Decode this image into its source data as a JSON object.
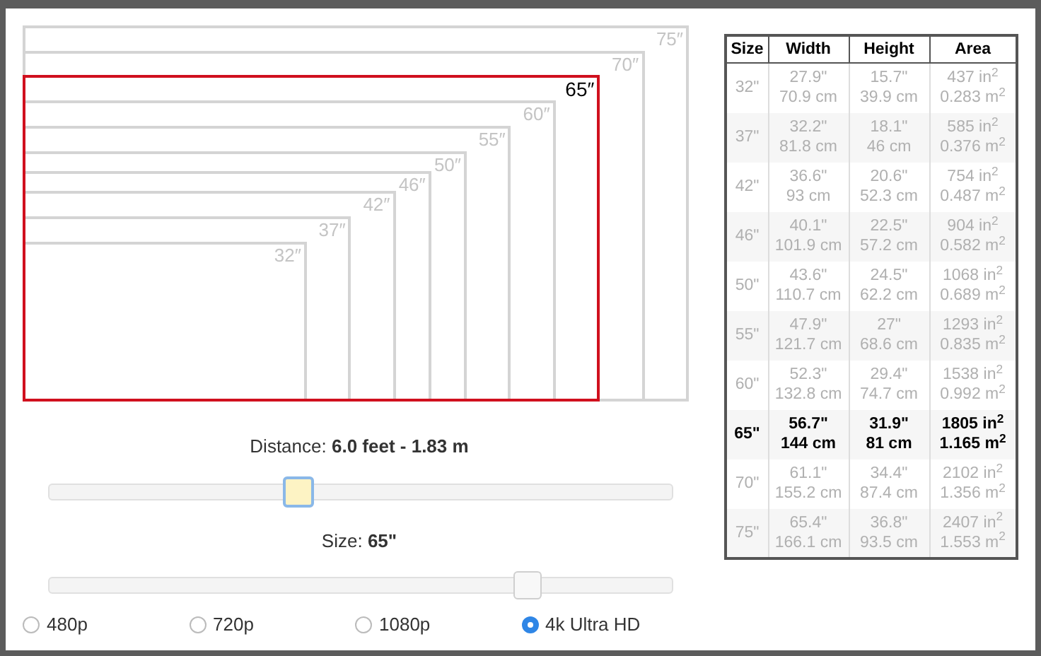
{
  "diagram": {
    "screens": [
      {
        "label": "75″",
        "selected": false
      },
      {
        "label": "70″",
        "selected": false
      },
      {
        "label": "65″",
        "selected": true
      },
      {
        "label": "60″",
        "selected": false
      },
      {
        "label": "55″",
        "selected": false
      },
      {
        "label": "50″",
        "selected": false
      },
      {
        "label": "46″",
        "selected": false
      },
      {
        "label": "42″",
        "selected": false
      },
      {
        "label": "37″",
        "selected": false
      },
      {
        "label": "32″",
        "selected": false
      }
    ]
  },
  "distance": {
    "label": "Distance: **6.0 feet - 1.83 m**",
    "slider": {
      "level": 0.4,
      "focused": true
    }
  },
  "size": {
    "label": "Size: **65\"**",
    "slider": {
      "level": 0.77,
      "focused": false
    }
  },
  "resolutions": [
    {
      "label": "480p",
      "selected": false
    },
    {
      "label": "720p",
      "selected": false
    },
    {
      "label": "1080p",
      "selected": false
    },
    {
      "label": "4k Ultra HD",
      "selected": true
    }
  ],
  "table": {
    "columns": [
      "Size",
      "Width",
      "Height",
      "Area"
    ],
    "rows": [
      {
        "selected": false,
        "cells": [
          "32\"",
          "27.9\"\n70.9 cm",
          "15.7\"\n39.9 cm",
          "437 in$^{2}$\n0.283 m$^{2}$"
        ]
      },
      {
        "selected": false,
        "cells": [
          "37\"",
          "32.2\"\n81.8 cm",
          "18.1\"\n46 cm",
          "585 in$^{2}$\n0.376 m$^{2}$"
        ]
      },
      {
        "selected": false,
        "cells": [
          "42\"",
          "36.6\"\n93 cm",
          "20.6\"\n52.3 cm",
          "754 in$^{2}$\n0.487 m$^{2}$"
        ]
      },
      {
        "selected": false,
        "cells": [
          "46\"",
          "40.1\"\n101.9 cm",
          "22.5\"\n57.2 cm",
          "904 in$^{2}$\n0.582 m$^{2}$"
        ]
      },
      {
        "selected": false,
        "cells": [
          "50\"",
          "43.6\"\n110.7 cm",
          "24.5\"\n62.2 cm",
          "1068 in$^{2}$\n0.689 m$^{2}$"
        ]
      },
      {
        "selected": false,
        "cells": [
          "55\"",
          "47.9\"\n121.7 cm",
          "27\"\n68.6 cm",
          "1293 in$^{2}$\n0.835 m$^{2}$"
        ]
      },
      {
        "selected": false,
        "cells": [
          "60\"",
          "52.3\"\n132.8 cm",
          "29.4\"\n74.7 cm",
          "1538 in$^{2}$\n0.992 m$^{2}$"
        ]
      },
      {
        "selected": true,
        "cells": [
          "65\"",
          "56.7\"\n144 cm",
          "31.9\"\n81 cm",
          "1805 in$^{2}$\n1.165 m$^{2}$"
        ]
      },
      {
        "selected": false,
        "cells": [
          "70\"",
          "61.1\"\n155.2 cm",
          "34.4\"\n87.4 cm",
          "2102 in$^{2}$\n1.356 m$^{2}$"
        ]
      },
      {
        "selected": false,
        "cells": [
          "75\"",
          "65.4\"\n166.1 cm",
          "36.8\"\n93.5 cm",
          "2407 in$^{2}$\n1.553 m$^{2}$"
        ]
      }
    ]
  }
}
